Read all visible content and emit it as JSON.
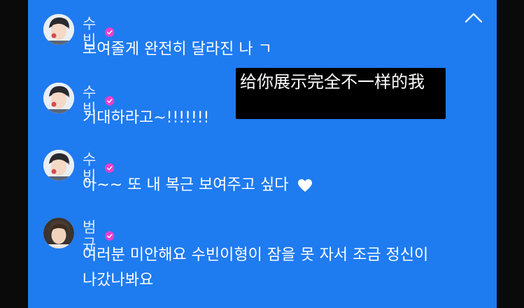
{
  "messages": [
    {
      "author": "수빈",
      "text": "보여줄게 완전히 달라진 나 ㄱ",
      "avatar_icon": "avatar-subin",
      "verified_icon": "verified-badge-icon"
    },
    {
      "author": "수빈",
      "text": "기대하라고~!!!!!!!",
      "avatar_icon": "avatar-subin",
      "verified_icon": "verified-badge-icon"
    },
    {
      "author": "수빈",
      "text": "아~~ 또 내 복근 보여주고 싶다",
      "avatar_icon": "avatar-subin",
      "verified_icon": "verified-badge-icon",
      "trailing_icon": "heart-icon"
    },
    {
      "author": "범규",
      "text": "여러분 미안해요 수빈이형이 잠을 못 자서 조금 정신이 나갔나봐요",
      "avatar_icon": "avatar-beomgyu",
      "verified_icon": "verified-badge-icon"
    }
  ],
  "subtitle": "给你展示完全不一样的我",
  "colors": {
    "panel": "#1f7bf0",
    "badge": "#e83fd0",
    "name": "#dcecff",
    "text": "#ffffff"
  },
  "controls": {
    "collapse_icon": "chevron-up-icon"
  }
}
